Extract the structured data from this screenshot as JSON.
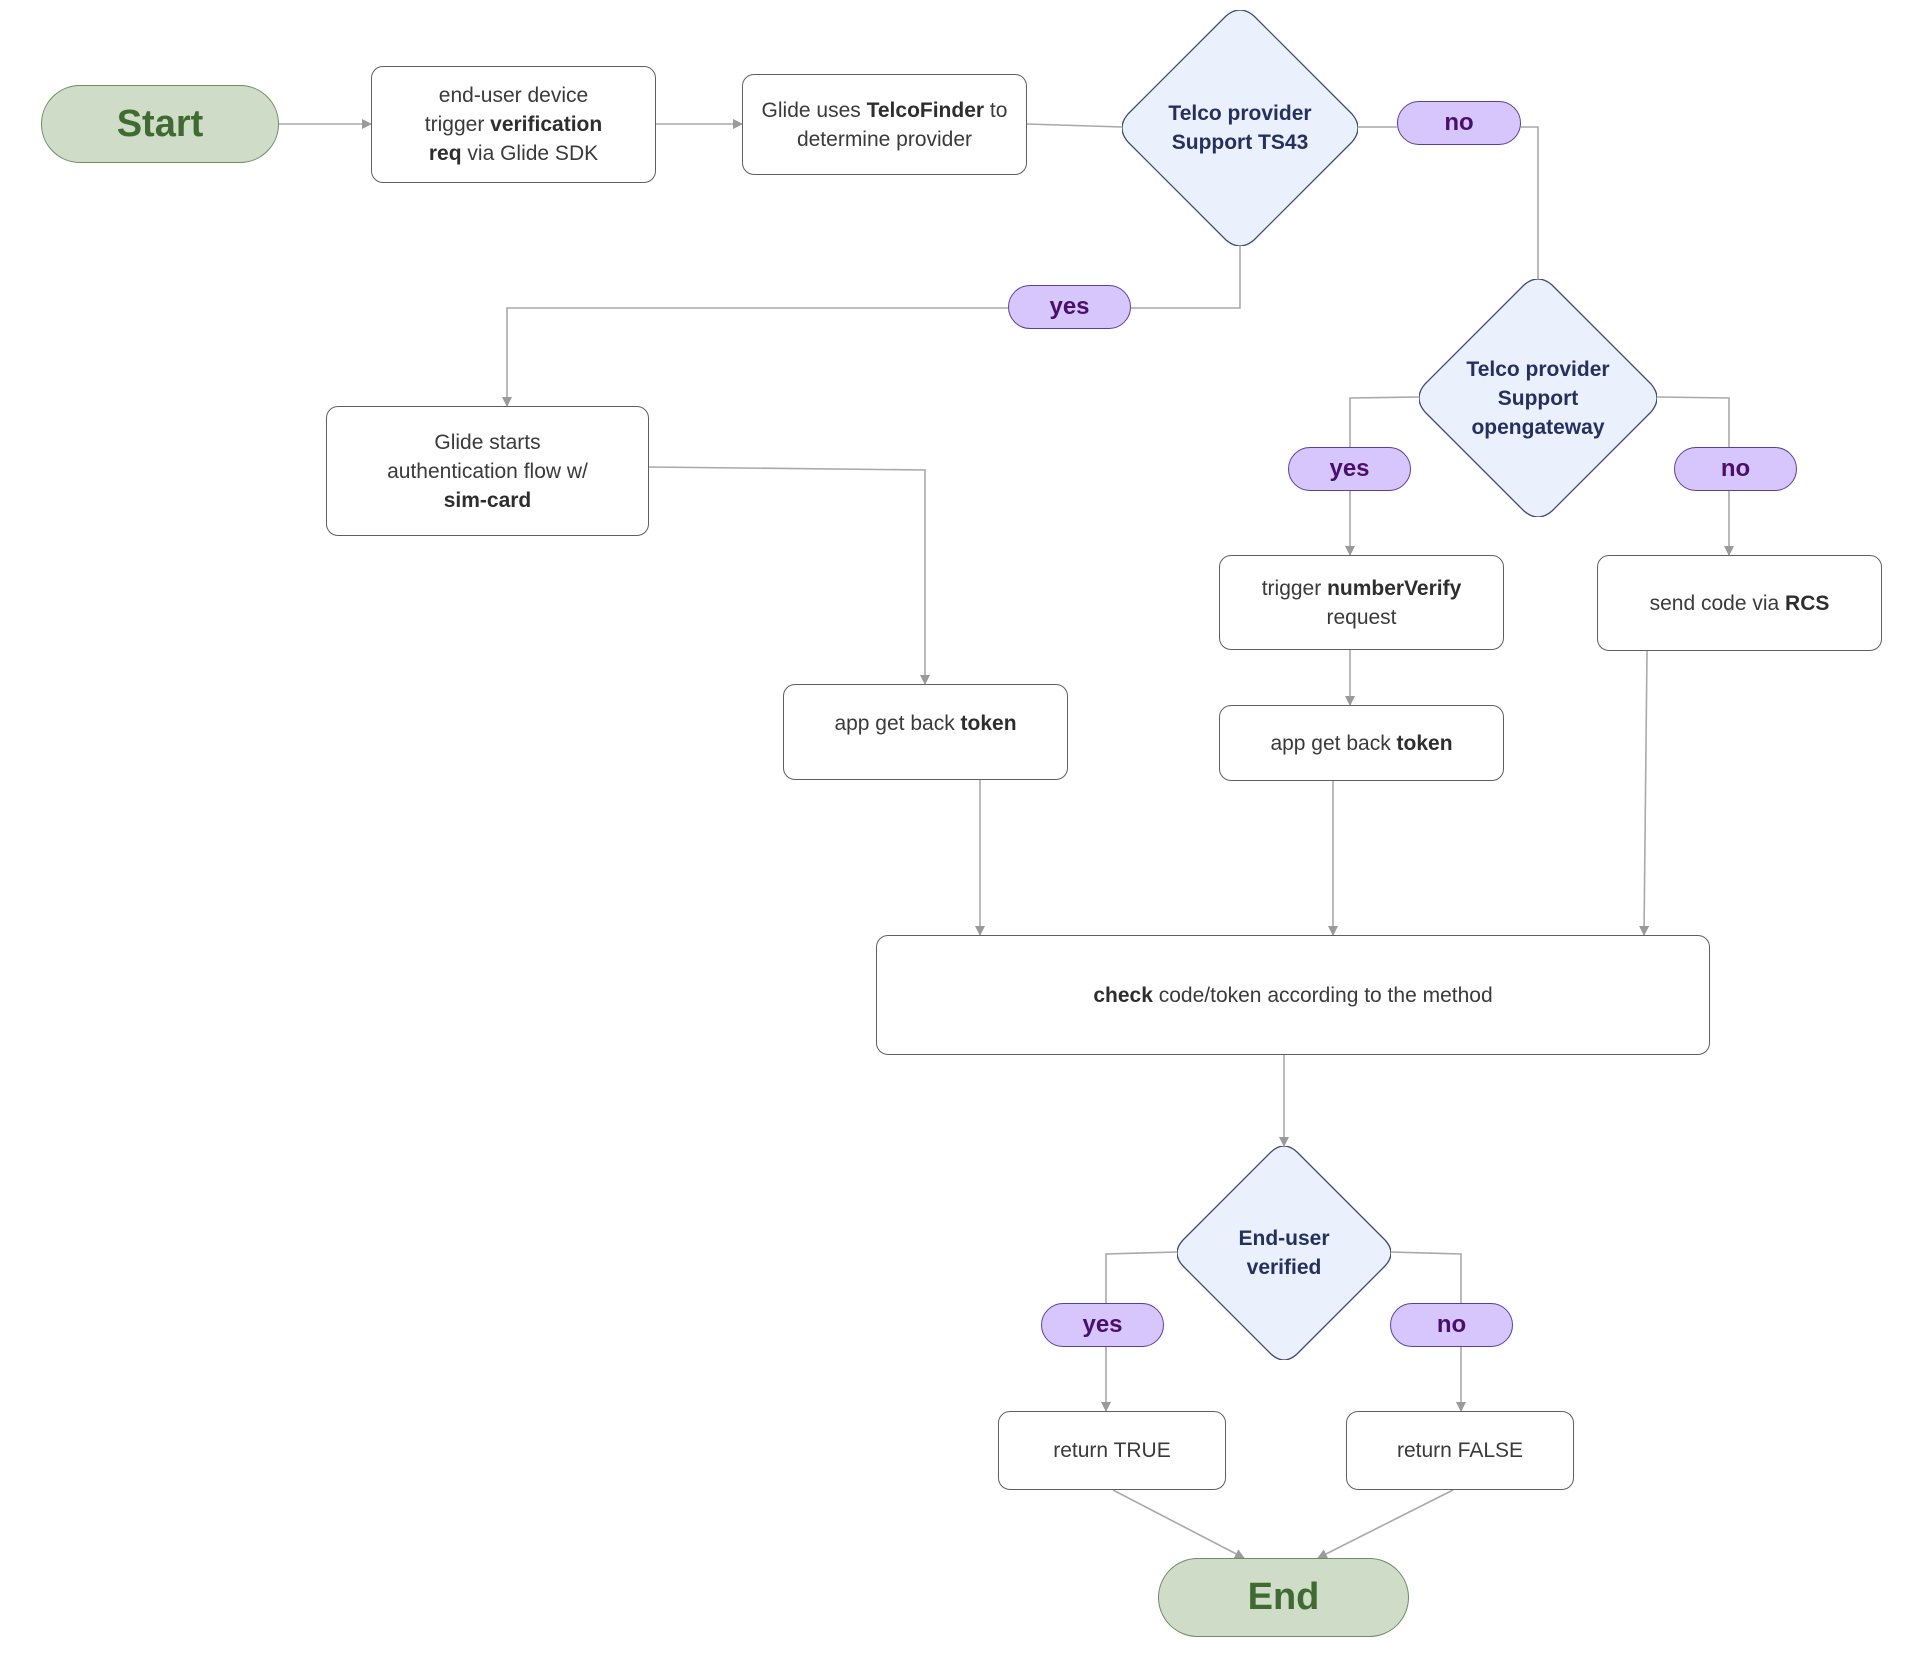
{
  "diagram": {
    "type": "flowchart",
    "colors": {
      "terminal_fill": "#cfdcc8",
      "terminal_text": "#3f6b33",
      "decision_fill": "#eaf1fd",
      "decision_border": "#3e4a7a",
      "decision_text": "#24305e",
      "pill_fill": "#d7c6fb",
      "pill_text": "#4a0f6c",
      "connector": "#a9a9a9"
    },
    "nodes": {
      "start": {
        "label": "Start"
      },
      "trigger_req": {
        "parts": [
          {
            "text": "end-user device trigger ",
            "bold": false
          },
          {
            "text": "verification req",
            "bold": true
          },
          {
            "text": " via Glide SDK",
            "bold": false
          }
        ]
      },
      "telcofinder": {
        "parts": [
          {
            "text": "Glide uses ",
            "bold": false
          },
          {
            "text": "TelcoFinder",
            "bold": true
          },
          {
            "text": " to determine provider",
            "bold": false
          }
        ]
      },
      "ts43": {
        "line1": "Telco provider",
        "line2": "Support TS43"
      },
      "opengateway": {
        "line1": "Telco provider",
        "line2": "Support",
        "line3": "opengateway"
      },
      "simcard": {
        "parts": [
          {
            "text": "Glide starts authentication flow w/ ",
            "bold": false
          },
          {
            "text": "sim-card",
            "bold": true
          }
        ]
      },
      "numberverify": {
        "parts": [
          {
            "text": "trigger ",
            "bold": false
          },
          {
            "text": "numberVerify",
            "bold": true
          },
          {
            "text": " request",
            "bold": false
          }
        ]
      },
      "rcs": {
        "parts": [
          {
            "text": "send code via ",
            "bold": false
          },
          {
            "text": "RCS",
            "bold": true
          }
        ]
      },
      "token1": {
        "parts": [
          {
            "text": "app get back ",
            "bold": false
          },
          {
            "text": "token",
            "bold": true
          }
        ]
      },
      "token2": {
        "parts": [
          {
            "text": "app get back ",
            "bold": false
          },
          {
            "text": "token",
            "bold": true
          }
        ]
      },
      "check": {
        "parts": [
          {
            "text": "check",
            "bold": true
          },
          {
            "text": " code/token according to the method",
            "bold": false
          }
        ]
      },
      "verified": {
        "line1": "End-user",
        "line2": "verified"
      },
      "return_true": {
        "label": "return TRUE"
      },
      "return_false": {
        "label": "return FALSE"
      },
      "end": {
        "label": "End"
      }
    },
    "branch_labels": {
      "ts43_yes": "yes",
      "ts43_no": "no",
      "ogw_yes": "yes",
      "ogw_no": "no",
      "verified_yes": "yes",
      "verified_no": "no"
    },
    "edges": [
      {
        "from": "start",
        "to": "trigger_req"
      },
      {
        "from": "trigger_req",
        "to": "telcofinder"
      },
      {
        "from": "telcofinder",
        "to": "ts43"
      },
      {
        "from": "ts43",
        "to": "simcard",
        "label": "yes"
      },
      {
        "from": "ts43",
        "to": "opengateway",
        "label": "no"
      },
      {
        "from": "simcard",
        "to": "token1"
      },
      {
        "from": "opengateway",
        "to": "numberverify",
        "label": "yes"
      },
      {
        "from": "opengateway",
        "to": "rcs",
        "label": "no"
      },
      {
        "from": "numberverify",
        "to": "token2"
      },
      {
        "from": "token1",
        "to": "check"
      },
      {
        "from": "token2",
        "to": "check"
      },
      {
        "from": "rcs",
        "to": "check"
      },
      {
        "from": "check",
        "to": "verified"
      },
      {
        "from": "verified",
        "to": "return_true",
        "label": "yes"
      },
      {
        "from": "verified",
        "to": "return_false",
        "label": "no"
      },
      {
        "from": "return_true",
        "to": "end"
      },
      {
        "from": "return_false",
        "to": "end"
      }
    ]
  }
}
